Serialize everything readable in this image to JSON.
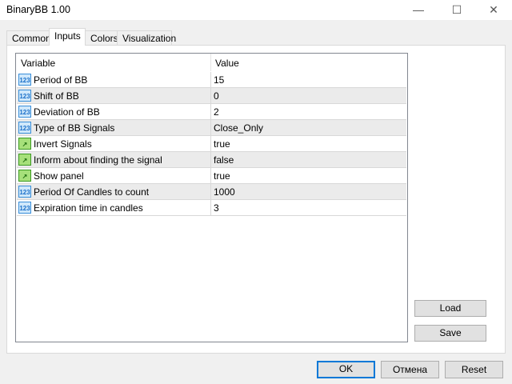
{
  "window": {
    "title": "BinaryBB 1.00",
    "minimize": "—",
    "maximize": "☐",
    "close": "✕"
  },
  "tabs": [
    {
      "label": "Common"
    },
    {
      "label": "Inputs"
    },
    {
      "label": "Colors"
    },
    {
      "label": "Visualization"
    }
  ],
  "table": {
    "headers": {
      "variable": "Variable",
      "value": "Value"
    },
    "rows": [
      {
        "icon": "number-icon",
        "variable": "Period of BB",
        "value": "15"
      },
      {
        "icon": "number-icon",
        "variable": "Shift of BB",
        "value": "0"
      },
      {
        "icon": "number-icon",
        "variable": "Deviation of BB",
        "value": "2"
      },
      {
        "icon": "number-icon",
        "variable": "Type of BB Signals",
        "value": "Close_Only"
      },
      {
        "icon": "boolean-icon",
        "variable": "Invert Signals",
        "value": "true"
      },
      {
        "icon": "boolean-icon",
        "variable": "Inform about finding the signal",
        "value": "false"
      },
      {
        "icon": "boolean-icon",
        "variable": "Show panel",
        "value": "true"
      },
      {
        "icon": "number-icon",
        "variable": "Period Of Candles to count",
        "value": "1000"
      },
      {
        "icon": "number-icon",
        "variable": "Expiration time in candles",
        "value": "3"
      }
    ]
  },
  "buttons": {
    "load": "Load",
    "save": "Save",
    "ok": "OK",
    "cancel": "Отмена",
    "reset": "Reset"
  },
  "icon_text": {
    "number": "123"
  }
}
